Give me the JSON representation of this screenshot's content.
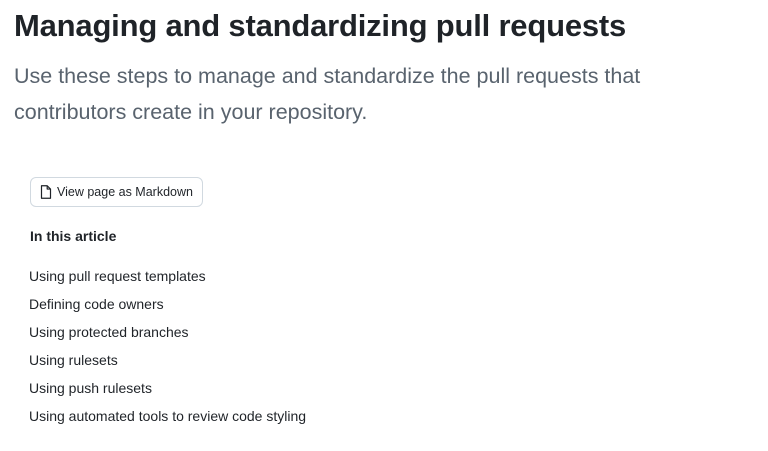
{
  "article": {
    "title": "Managing and standardizing pull requests",
    "intro": "Use these steps to manage and standardize the pull requests that contributors create in your repository."
  },
  "markdown_button": {
    "label": "View page as Markdown",
    "icon": "file-icon"
  },
  "toc": {
    "heading": "In this article",
    "items": [
      "Using pull request templates",
      "Defining code owners",
      "Using protected branches",
      "Using rulesets",
      "Using push rulesets",
      "Using automated tools to review code styling"
    ]
  }
}
